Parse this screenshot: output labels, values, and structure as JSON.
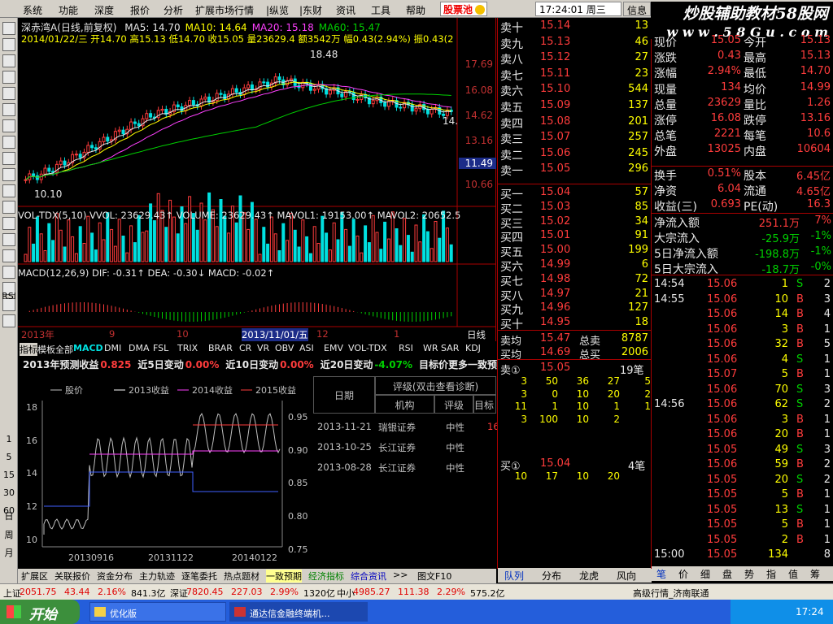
{
  "menu": [
    "系统",
    "功能",
    "深度",
    "报价",
    "分析",
    "扩展市场行情",
    "|纵览",
    "|东财",
    "资讯",
    "工具",
    "帮助"
  ],
  "pool_label": "股票池",
  "clock": "17:24:01 周三",
  "menu_right": [
    "信息",
    "行"
  ],
  "brand": "炒股辅助教材58股网",
  "brand_url": "w w w . 5 8 G u . c o m",
  "toolbar_labels": [
    "RSI",
    "日",
    "周",
    "月",
    "1",
    "5",
    "15",
    "30",
    "60"
  ],
  "chart": {
    "title": "深赤湾A(日线,前复权)",
    "ma": [
      {
        "label": "MA5: 14.70",
        "color": "#e8e8e8"
      },
      {
        "label": "MA10: 14.64",
        "color": "#ffff00"
      },
      {
        "label": "MA20: 15.18",
        "color": "#ff40ff"
      },
      {
        "label": "MA60: 15.47",
        "color": "#00d000"
      }
    ],
    "info": "2014/01/22/三 开14.70 高15.13 低14.70 收15.05 量23629.4 额3542万 幅0.43(2.94%) 振0.43(2",
    "high_mark": "18.48",
    "low_mark": "10.10",
    "price_ticks": [
      "17.69",
      "16.08",
      "14.62",
      "13.16",
      "11.49",
      "10.66"
    ],
    "right_last": "14.",
    "vol_title": "VOL-TDX(5,10) VVOL: 23629.43↑ VOLUME: 23629.43↑ MAVOL1: 19153.00↑ MAVOL2: 20652.5",
    "vol_ticks": [
      "30000",
      "15000",
      "X10"
    ],
    "macd_title": "MACD(12,26,9) DIF: -0.31↑ DEA: -0.30↓ MACD: -0.02↑",
    "macd_ticks": [
      "1.00",
      "0.00"
    ],
    "time_axis": [
      "2013年",
      "9",
      "10",
      "2013/11/01/五",
      "12",
      "1"
    ],
    "period": "日线"
  },
  "indicator_tabs": [
    "指标",
    "模板",
    "全部",
    "MACD",
    "DMI",
    "DMA",
    "FSL",
    "TRIX",
    "BRAR",
    "CR",
    "VR",
    "OBV",
    "ASI",
    "EMV",
    "VOL-TDX",
    "RSI",
    "WR",
    "SAR",
    "KDJ"
  ],
  "forecast": {
    "text": [
      {
        "t": "2013年预测收益",
        "c": "wht"
      },
      {
        "t": "0.825",
        "c": "red"
      },
      {
        "t": "近5日变动",
        "c": "wht"
      },
      {
        "t": "0.00%",
        "c": "red"
      },
      {
        "t": "近10日变动",
        "c": "wht"
      },
      {
        "t": "0.00%",
        "c": "red"
      },
      {
        "t": "近20日变动",
        "c": "wht"
      },
      {
        "t": "-4.07%",
        "c": "grn"
      },
      {
        "t": "目标价更多一致预期...",
        "c": "wht"
      }
    ]
  },
  "mini_chart": {
    "legend": [
      "股价",
      "2013收益",
      "2014收益",
      "2015收益"
    ],
    "left_ticks": [
      "18",
      "16",
      "14",
      "12",
      "10"
    ],
    "right_ticks": [
      "0.95",
      "0.90",
      "0.85",
      "0.80",
      "0.75"
    ],
    "dates": [
      "20130916",
      "20131122",
      "20140122"
    ]
  },
  "rating": {
    "header": "评级(双击查看诊断)",
    "cols": [
      "日期",
      "机构",
      "评级",
      "目标"
    ],
    "rows": [
      [
        "2013-11-21",
        "瑞银证券",
        "中性",
        "16"
      ],
      [
        "2013-10-25",
        "长江证券",
        "中性",
        ""
      ],
      [
        "2013-08-28",
        "长江证券",
        "中性",
        ""
      ]
    ]
  },
  "bottom_tabs": [
    "扩展区",
    "关联报价",
    "资金分布",
    "主力轨迹",
    "逐笔委托",
    "热点题材",
    "一致预期",
    "经济指标",
    "综合资讯",
    ">>",
    "图文F10"
  ],
  "order_book": {
    "sells": [
      [
        "卖十",
        "15.14",
        "13"
      ],
      [
        "卖九",
        "15.13",
        "46"
      ],
      [
        "卖八",
        "15.12",
        "27"
      ],
      [
        "卖七",
        "15.11",
        "23"
      ],
      [
        "卖六",
        "15.10",
        "544"
      ],
      [
        "卖五",
        "15.09",
        "137"
      ],
      [
        "卖四",
        "15.08",
        "201"
      ],
      [
        "卖三",
        "15.07",
        "257"
      ],
      [
        "卖二",
        "15.06",
        "245"
      ],
      [
        "卖一",
        "15.05",
        "296"
      ]
    ],
    "buys": [
      [
        "买一",
        "15.04",
        "57"
      ],
      [
        "买二",
        "15.03",
        "85"
      ],
      [
        "买三",
        "15.02",
        "34"
      ],
      [
        "买四",
        "15.01",
        "91"
      ],
      [
        "买五",
        "15.00",
        "199"
      ],
      [
        "买六",
        "14.99",
        "6"
      ],
      [
        "买七",
        "14.98",
        "72"
      ],
      [
        "买八",
        "14.97",
        "21"
      ],
      [
        "买九",
        "14.96",
        "127"
      ],
      [
        "买十",
        "14.95",
        "18"
      ]
    ],
    "avg": [
      [
        "卖均",
        "15.47",
        "总卖",
        "8787"
      ],
      [
        "买均",
        "14.69",
        "总买",
        "2006"
      ]
    ],
    "sell_queue_head": [
      "卖①",
      "15.05",
      "19笔"
    ],
    "sell_queue": [
      [
        "3",
        "50",
        "36",
        "27",
        "5"
      ],
      [
        "3",
        "0",
        "10",
        "20",
        "2"
      ],
      [
        "11",
        "1",
        "10",
        "1",
        "1"
      ],
      [
        "3",
        "100",
        "10",
        "2",
        ""
      ]
    ],
    "buy_queue_head": [
      "买①",
      "15.04",
      "4笔"
    ],
    "buy_queue": [
      [
        "10",
        "17",
        "10",
        "20"
      ]
    ],
    "tabs": [
      "队列",
      "分布",
      "龙虎",
      "风向"
    ]
  },
  "quote": {
    "rows": [
      [
        "现价",
        "15.05",
        "今开",
        "15.13"
      ],
      [
        "涨跌",
        "0.43",
        "最高",
        "15.13"
      ],
      [
        "涨幅",
        "2.94%",
        "最低",
        "14.70"
      ],
      [
        "现量",
        "134",
        "均价",
        "14.99"
      ],
      [
        "总量",
        "23629",
        "量比",
        "1.26"
      ],
      [
        "涨停",
        "16.08",
        "跌停",
        "13.16"
      ],
      [
        "总笔",
        "2221",
        "每笔",
        "10.6"
      ],
      [
        "外盘",
        "13025",
        "内盘",
        "10604"
      ]
    ],
    "rows2": [
      [
        "换手",
        "0.51%",
        "股本",
        "6.45亿"
      ],
      [
        "净资",
        "6.04",
        "流通",
        "4.65亿"
      ],
      [
        "收益(三)",
        "0.693",
        "PE(动)",
        "16.3"
      ]
    ],
    "flows": [
      [
        "净流入额",
        "251.1万",
        "7%"
      ],
      [
        "大宗流入",
        "-25.9万",
        "-1%"
      ],
      [
        "5日净流入额",
        "-198.8万",
        "-1%"
      ],
      [
        "5日大宗流入",
        "-18.7万",
        "-0%"
      ]
    ]
  },
  "ticks": [
    [
      "14:54",
      "15.06",
      "1",
      "S",
      "2"
    ],
    [
      "14:55",
      "15.06",
      "10",
      "B",
      "3"
    ],
    [
      "",
      "15.06",
      "14",
      "B",
      "4"
    ],
    [
      "",
      "15.06",
      "3",
      "B",
      "1"
    ],
    [
      "",
      "15.06",
      "32",
      "B",
      "5"
    ],
    [
      "",
      "15.06",
      "4",
      "S",
      "1"
    ],
    [
      "",
      "15.07",
      "5",
      "B",
      "1"
    ],
    [
      "",
      "15.06",
      "70",
      "S",
      "3"
    ],
    [
      "14:56",
      "15.06",
      "62",
      "S",
      "2"
    ],
    [
      "",
      "15.06",
      "3",
      "B",
      "1"
    ],
    [
      "",
      "15.06",
      "20",
      "B",
      "1"
    ],
    [
      "",
      "15.05",
      "49",
      "S",
      "3"
    ],
    [
      "",
      "15.06",
      "59",
      "B",
      "2"
    ],
    [
      "",
      "15.05",
      "20",
      "S",
      "2"
    ],
    [
      "",
      "15.05",
      "5",
      "B",
      "1"
    ],
    [
      "",
      "15.05",
      "13",
      "S",
      "1"
    ],
    [
      "",
      "15.05",
      "5",
      "B",
      "1"
    ],
    [
      "",
      "15.05",
      "2",
      "B",
      "1"
    ],
    [
      "15:00",
      "15.05",
      "134",
      "",
      "8"
    ]
  ],
  "right_tabs": [
    "笔",
    "价",
    "细",
    "盘",
    "势",
    "指",
    "值",
    "筹"
  ],
  "status": [
    {
      "t": "上证",
      "c": "#000"
    },
    {
      "t": "2051.75",
      "c": "#e00000"
    },
    {
      "t": "43.44",
      "c": "#e00000"
    },
    {
      "t": "2.16%",
      "c": "#e00000"
    },
    {
      "t": "841.3亿",
      "c": "#000"
    },
    {
      "t": "深证",
      "c": "#000"
    },
    {
      "t": "7820.45",
      "c": "#e00000"
    },
    {
      "t": "227.03",
      "c": "#e00000"
    },
    {
      "t": "2.99%",
      "c": "#e00000"
    },
    {
      "t": "1320亿",
      "c": "#000"
    },
    {
      "t": "中小",
      "c": "#000"
    },
    {
      "t": "4985.27",
      "c": "#e00000"
    },
    {
      "t": "111.38",
      "c": "#e00000"
    },
    {
      "t": "2.29%",
      "c": "#e00000"
    },
    {
      "t": "575.2亿",
      "c": "#000"
    }
  ],
  "status_right": "高级行情_济南联通",
  "taskbar": {
    "start": "开始",
    "tasks": [
      "优化版",
      "通达信金融终端机..."
    ],
    "time": "17:24"
  }
}
